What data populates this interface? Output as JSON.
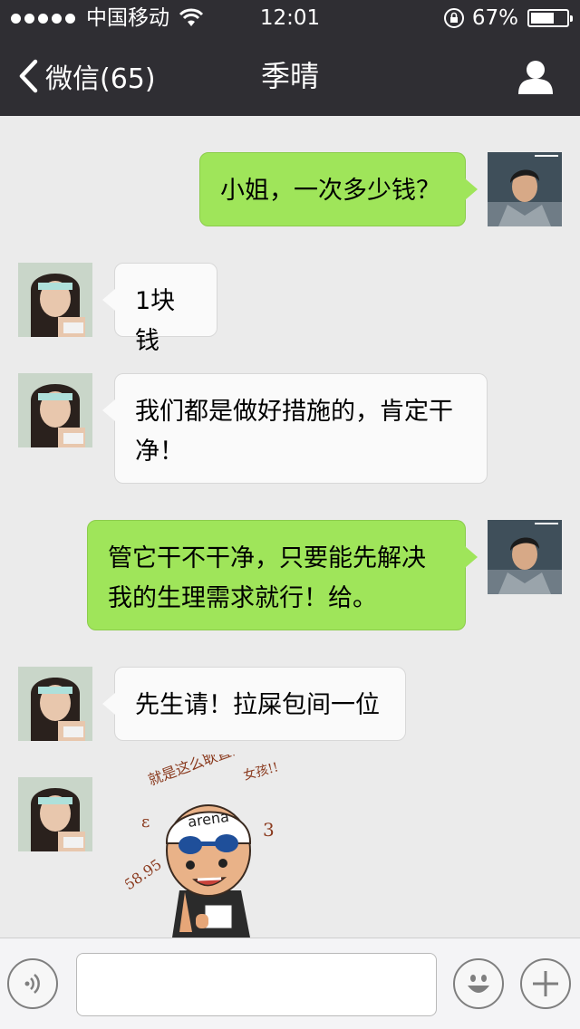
{
  "status_bar": {
    "carrier": "中国移动",
    "time": "12:01",
    "battery_percent": "67%",
    "battery_level": 0.67,
    "signal_dots": 5
  },
  "nav": {
    "back_label": "微信(65)",
    "title": "季晴"
  },
  "messages": [
    {
      "side": "me",
      "text": "小姐，一次多少钱？"
    },
    {
      "side": "them",
      "text": "1块钱"
    },
    {
      "side": "them",
      "text": "我们都是做好措施的，肯定干净！"
    },
    {
      "side": "me",
      "text": "管它干不干净，只要能先解决我的生理需求就行！给。"
    },
    {
      "side": "them",
      "text": "先生请！拉屎包间一位"
    },
    {
      "side": "them",
      "type": "sticker",
      "sticker": {
        "caption_line1": "就是这么耿直的",
        "caption_line2": "女孩!!",
        "cap_text": "arena",
        "side_text": "58.95"
      }
    }
  ],
  "colors": {
    "header_bg": "#2f2e33",
    "chat_bg": "#ebebeb",
    "my_bubble": "#9fe55a",
    "their_bubble": "#fafafa"
  },
  "icons": {
    "back": "chevron-left-icon",
    "profile": "person-icon",
    "voice": "voice-icon",
    "emoji": "smiley-icon",
    "more": "plus-icon",
    "wifi": "wifi-icon",
    "lock": "rotation-lock-icon"
  }
}
